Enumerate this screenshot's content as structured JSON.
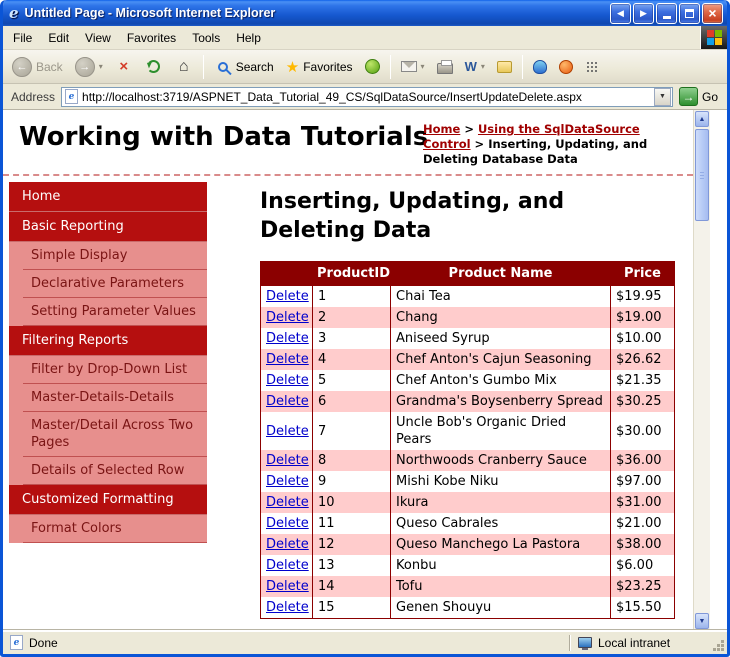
{
  "titlebar": {
    "title": "Untitled Page - Microsoft Internet Explorer"
  },
  "menubar": {
    "items": [
      "File",
      "Edit",
      "View",
      "Favorites",
      "Tools",
      "Help"
    ]
  },
  "toolbar": {
    "back_label": "Back",
    "search_label": "Search",
    "favorites_label": "Favorites"
  },
  "addressbar": {
    "label": "Address",
    "url": "http://localhost:3719/ASPNET_Data_Tutorial_49_CS/SqlDataSource/InsertUpdateDelete.aspx",
    "go_label": "Go"
  },
  "statusbar": {
    "left": "Done",
    "right": "Local intranet"
  },
  "icons": {
    "ie_logo": "e",
    "move_left": "◀",
    "move_right": "▶",
    "close": "×",
    "back_arrow": "←",
    "forward_arrow": "→",
    "home": "⌂",
    "star": "★",
    "word": "W",
    "dropdown": "▼",
    "caret": "▾",
    "go_arrow": "→",
    "scroll_up": "▲",
    "scroll_down": "▼"
  },
  "page": {
    "site_title": "Working with Data Tutorials",
    "breadcrumb": {
      "separator": " > ",
      "items": [
        {
          "text": "Home",
          "link": true
        },
        {
          "text": "Using the SqlDataSource Control",
          "link": true
        },
        {
          "text": "Inserting, Updating, and Deleting Database Data",
          "link": false
        }
      ]
    },
    "heading": "Inserting, Updating, and Deleting Data",
    "sidebar": {
      "items": [
        {
          "label": "Home",
          "type": "section"
        },
        {
          "label": "Basic Reporting",
          "type": "section"
        },
        {
          "label": "Simple Display",
          "type": "link"
        },
        {
          "label": "Declarative Parameters",
          "type": "link"
        },
        {
          "label": "Setting Parameter Values",
          "type": "link"
        },
        {
          "label": "Filtering Reports",
          "type": "section"
        },
        {
          "label": "Filter by Drop-Down List",
          "type": "link"
        },
        {
          "label": "Master-Details-Details",
          "type": "link"
        },
        {
          "label": "Master/Detail Across Two Pages",
          "type": "link"
        },
        {
          "label": "Details of Selected Row",
          "type": "link"
        },
        {
          "label": "Customized Formatting",
          "type": "section"
        },
        {
          "label": "Format Colors",
          "type": "link"
        }
      ]
    },
    "products_table": {
      "headers": [
        "",
        "ProductID",
        "Product Name",
        "Price"
      ],
      "action_label": "Delete",
      "rows": [
        {
          "id": "1",
          "name": "Chai Tea",
          "price": "$19.95"
        },
        {
          "id": "2",
          "name": "Chang",
          "price": "$19.00"
        },
        {
          "id": "3",
          "name": "Aniseed Syrup",
          "price": "$10.00"
        },
        {
          "id": "4",
          "name": "Chef Anton's Cajun Seasoning",
          "price": "$26.62"
        },
        {
          "id": "5",
          "name": "Chef Anton's Gumbo Mix",
          "price": "$21.35"
        },
        {
          "id": "6",
          "name": "Grandma's Boysenberry Spread",
          "price": "$30.25"
        },
        {
          "id": "7",
          "name": "Uncle Bob's Organic Dried Pears",
          "price": "$30.00"
        },
        {
          "id": "8",
          "name": "Northwoods Cranberry Sauce",
          "price": "$36.00"
        },
        {
          "id": "9",
          "name": "Mishi Kobe Niku",
          "price": "$97.00"
        },
        {
          "id": "10",
          "name": "Ikura",
          "price": "$31.00"
        },
        {
          "id": "11",
          "name": "Queso Cabrales",
          "price": "$21.00"
        },
        {
          "id": "12",
          "name": "Queso Manchego La Pastora",
          "price": "$38.00"
        },
        {
          "id": "13",
          "name": "Konbu",
          "price": "$6.00"
        },
        {
          "id": "14",
          "name": "Tofu",
          "price": "$23.25"
        },
        {
          "id": "15",
          "name": "Genen Shouyu",
          "price": "$15.50"
        }
      ]
    }
  },
  "colors": {
    "accent_red": "#B50F0F",
    "table_header": "#8B0000",
    "row_alt": "#FFCCCC",
    "sidebar_item_bg": "#E78F8D",
    "link_blue": "#0000CC",
    "breadcrumb_link": "#A00000"
  }
}
